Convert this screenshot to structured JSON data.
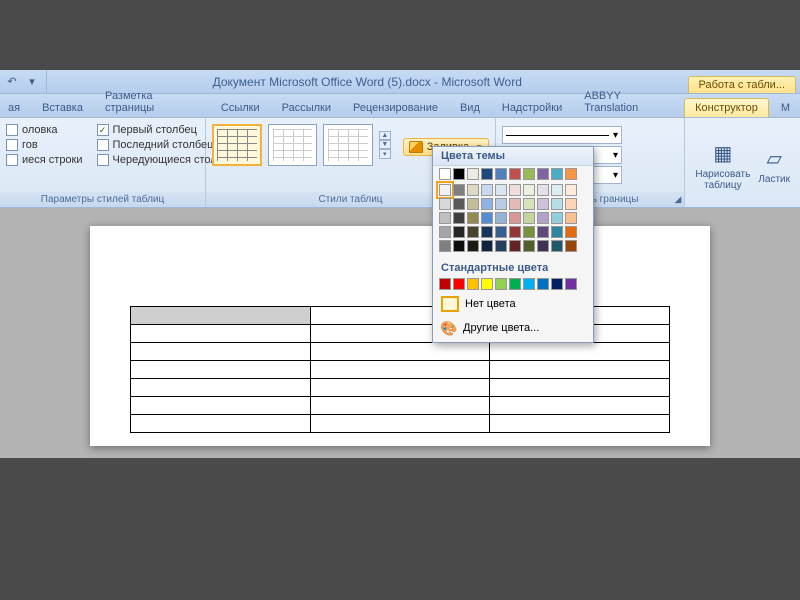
{
  "title": "Документ Microsoft Office Word (5).docx - Microsoft Word",
  "context_tab_label": "Работа с табли...",
  "tabs": {
    "t0": "ая",
    "t1": "Вставка",
    "t2": "Разметка страницы",
    "t3": "Ссылки",
    "t4": "Рассылки",
    "t5": "Рецензирование",
    "t6": "Вид",
    "t7": "Надстройки",
    "t8": "ABBYY Translation",
    "t9": "Конструктор",
    "t10": "М"
  },
  "opts": {
    "header_row": "оловка",
    "total_row": "гов",
    "banded_rows": "иеся строки",
    "first_col": "Первый столбец",
    "last_col": "Последний столбец",
    "banded_cols": "Чередующиеся столбцы"
  },
  "group_labels": {
    "opts": "Параметры стилей таблиц",
    "styles": "Стили таблиц",
    "borders": "Нарисовать границы"
  },
  "shading_btn": "Заливка ▾",
  "shading_label_plain": "Заливка",
  "color_picker": {
    "theme_header": "Цвета темы",
    "standard_header": "Стандартные цвета",
    "no_color": "Нет цвета",
    "more_colors": "Другие цвета...",
    "theme_row": [
      "#ffffff",
      "#000000",
      "#eeece1",
      "#1f497d",
      "#4f81bd",
      "#c0504d",
      "#9bbb59",
      "#8064a2",
      "#4bacc6",
      "#f79646"
    ],
    "shades": [
      [
        "#f2f2f2",
        "#7f7f7f",
        "#ddd9c3",
        "#c6d9f0",
        "#dbe5f1",
        "#f2dcdb",
        "#ebf1dd",
        "#e5e0ec",
        "#dbeef3",
        "#fdeada"
      ],
      [
        "#d8d8d8",
        "#595959",
        "#c4bd97",
        "#8db3e2",
        "#b8cce4",
        "#e5b9b7",
        "#d7e3bc",
        "#ccc1d9",
        "#b7dde8",
        "#fbd5b5"
      ],
      [
        "#bfbfbf",
        "#3f3f3f",
        "#938953",
        "#548dd4",
        "#95b3d7",
        "#d99694",
        "#c3d69b",
        "#b2a2c7",
        "#92cddc",
        "#fac08f"
      ],
      [
        "#a5a5a5",
        "#262626",
        "#494429",
        "#17365d",
        "#366092",
        "#953734",
        "#76923c",
        "#5f497a",
        "#31859b",
        "#e36c09"
      ],
      [
        "#7f7f7f",
        "#0c0c0c",
        "#1d1b10",
        "#0f243e",
        "#244061",
        "#632423",
        "#4f6128",
        "#3f3151",
        "#205867",
        "#974806"
      ]
    ],
    "standard_row": [
      "#c00000",
      "#ff0000",
      "#ffc000",
      "#ffff00",
      "#92d050",
      "#00b050",
      "#00b0f0",
      "#0070c0",
      "#002060",
      "#7030a0"
    ]
  },
  "combo": {
    "pen_style": "",
    "pen_weight": "",
    "pen_color": ""
  },
  "tools": {
    "draw_table": "Нарисовать\nтаблицу",
    "eraser": "Ластик"
  }
}
